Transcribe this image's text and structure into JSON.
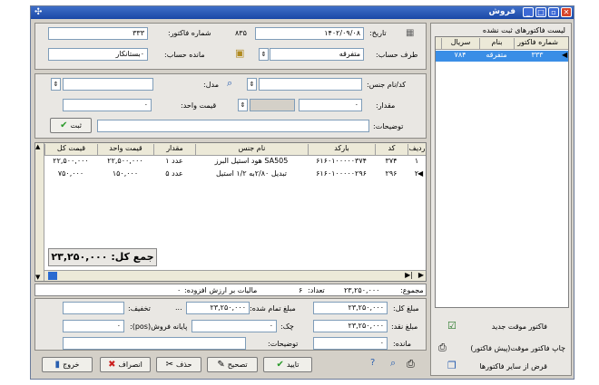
{
  "window": {
    "title": "فروش",
    "accent": "#1a48a6"
  },
  "header": {
    "date_label": "تاریخ:",
    "date_value": "۱۴۰۲/۰۹/۰۸",
    "invoice_no_label": "شماره فاکتور:",
    "invoice_no_value": "۳۳۳",
    "counter_value": "۸۳۵",
    "account_side_label": "طرف حساب:",
    "account_side_value": "متفرقه",
    "balance_label": "مانده حساب:",
    "balance_value": "۰بستانکار"
  },
  "item_entry": {
    "code_label": "کد/نام جنس:",
    "code_value": "",
    "model_label": "مدل:",
    "model_value": "",
    "qty_label": "مقدار:",
    "qty_value": "۰",
    "unit_price_label": "قیمت واحد:",
    "unit_price_value": "۰",
    "desc_label": "توضیحات:",
    "desc_value": "",
    "submit_label": "ثبت"
  },
  "items_table": {
    "columns": [
      "ردیف",
      "کد",
      "بارکد",
      "نام جنس",
      "مقدار",
      "قیمت واحد",
      "قیمت کل"
    ],
    "rows": [
      {
        "row": "۱",
        "code": "۳۷۴",
        "barcode": "۶۱۶۰۱۰۰۰۰۰۳۷۴",
        "name": "هود استیل البرز SA505",
        "qty": "۱ عدد",
        "unit_price": "۲۲,۵۰۰,۰۰۰",
        "total": "۲۲,۵۰۰,۰۰۰"
      },
      {
        "row": "۲",
        "code": "۲۹۶",
        "barcode": "۶۱۶۰۱۰۰۰۰۰۲۹۶",
        "name": "تبدیل ۲/۸۰به ۱/۲ استیل",
        "qty": "۵ عدد",
        "unit_price": "۱۵۰,۰۰۰",
        "total": "۷۵۰,۰۰۰"
      }
    ],
    "grand_total": "جمع کل: ۲۳,۲۵۰,۰۰۰"
  },
  "status": {
    "sum_label": "مجموع:",
    "sum_value": "۲۳,۲۵۰,۰۰۰",
    "count_label": "تعداد:",
    "count_value": "۶",
    "vat_label": "مالیات بر ارزش افزوده:",
    "vat_value": "۰"
  },
  "totals": {
    "total_amount_label": "مبلغ کل:",
    "total_amount_value": "۲۳,۲۵۰,۰۰۰",
    "final_amount_label": "مبلغ تمام شده:",
    "final_amount_value": "۲۳,۲۵۰,۰۰۰",
    "discount_label": "تخفیف:",
    "discount_value": "",
    "cash_label": "مبلغ نقد:",
    "cash_value": "۲۳,۲۵۰,۰۰۰",
    "check_label": "چک:",
    "check_value": "۰",
    "pos_label": "پایانه فروش(pos):",
    "pos_value": "۰",
    "remain_label": "مانده:",
    "remain_value": "۰",
    "notes_label": "توضیحات:",
    "notes_value": "",
    "dots": "..."
  },
  "buttons": {
    "confirm": "تایید",
    "edit": "تصحیح",
    "delete": "حذف",
    "cancel": "انصراف",
    "exit": "خروج"
  },
  "side": {
    "title": "لیست فاکتورهای ثبت نشده",
    "columns": [
      "شماره فاکتور",
      "بنام",
      "سریال"
    ],
    "rows": [
      {
        "invoice": "۳۳۳",
        "name": "متفرقه",
        "serial": "۷۸۴"
      }
    ],
    "action_new": "فاکتور موقت جدید",
    "action_print": "چاپ فاکتور موقت(پیش فاکتور)",
    "action_loan": "قرض از سایر فاکتورها"
  }
}
